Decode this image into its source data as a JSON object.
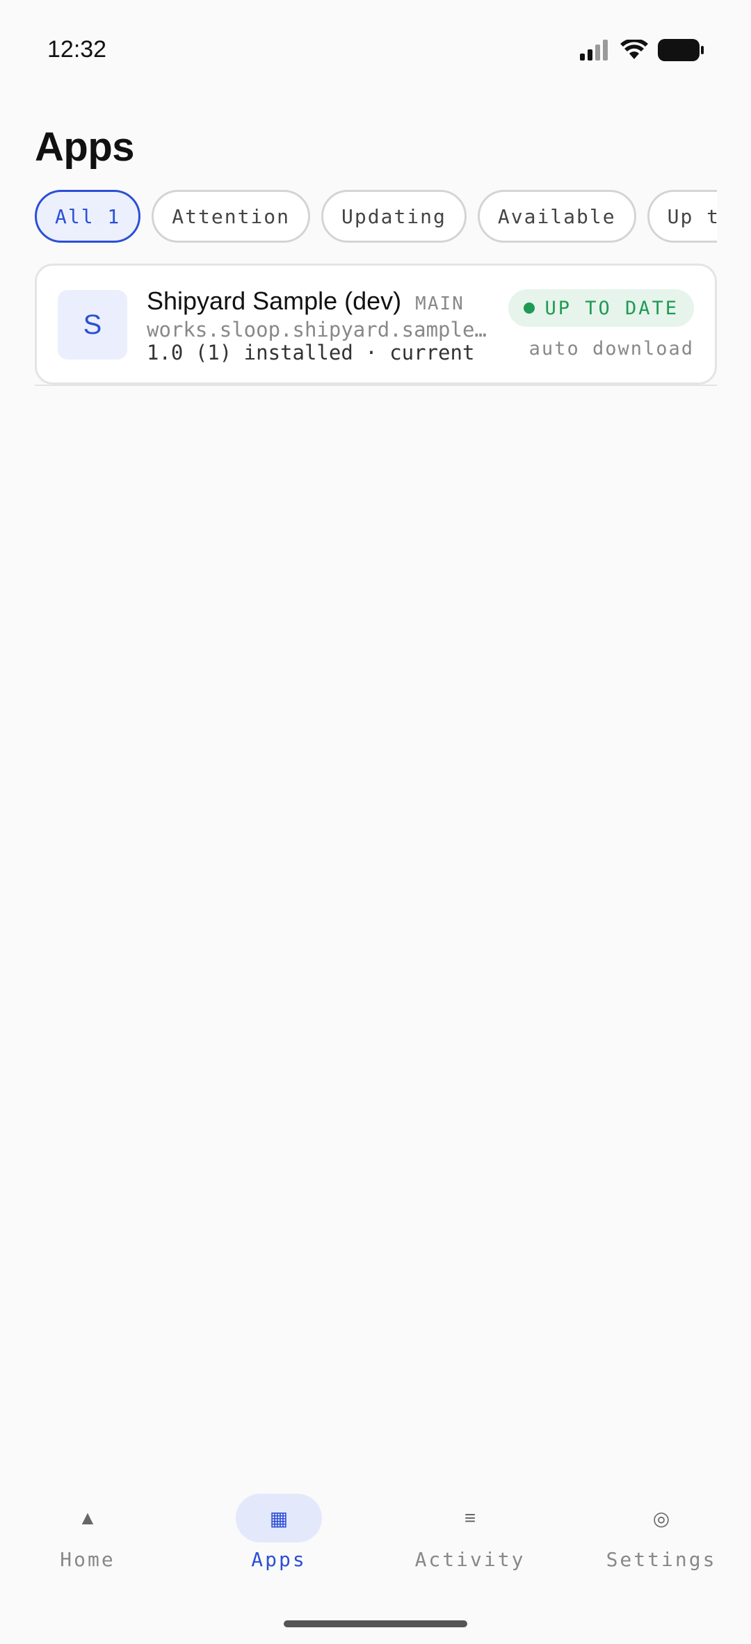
{
  "status_bar": {
    "time": "12:32"
  },
  "page": {
    "title": "Apps"
  },
  "filters": [
    {
      "label": "All 1",
      "active": true
    },
    {
      "label": "Attention",
      "active": false
    },
    {
      "label": "Updating",
      "active": false
    },
    {
      "label": "Available",
      "active": false
    },
    {
      "label": "Up to date",
      "active": false
    }
  ],
  "apps": [
    {
      "avatar_letter": "S",
      "name": "Shipyard Sample (dev)",
      "channel": "MAIN",
      "bundle_id": "works.sloop.shipyard.sampletest",
      "version_line": "1.0 (1) installed · current",
      "status": "UP TO DATE",
      "download_mode": "auto download"
    }
  ],
  "bottom_nav": [
    {
      "label": "Home",
      "icon": "triangle-icon",
      "glyph": "▲",
      "active": false
    },
    {
      "label": "Apps",
      "icon": "grid-icon",
      "glyph": "▦",
      "active": true
    },
    {
      "label": "Activity",
      "icon": "list-icon",
      "glyph": "≡",
      "active": false
    },
    {
      "label": "Settings",
      "icon": "target-icon",
      "glyph": "◎",
      "active": false
    }
  ],
  "colors": {
    "accent": "#2c4fd6",
    "status_green": "#1f9a52",
    "background": "#fafafa"
  }
}
